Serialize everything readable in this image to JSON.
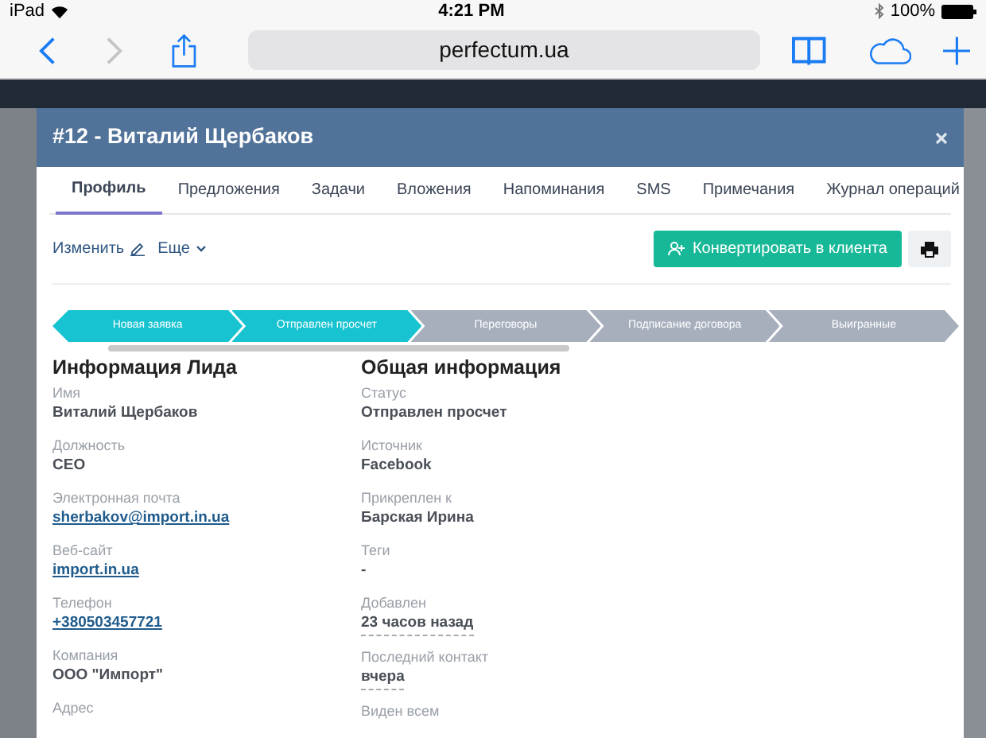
{
  "status_bar": {
    "device": "iPad",
    "time": "4:21 PM",
    "battery": "100%"
  },
  "browser": {
    "url": "perfectum.ua",
    "back_disabled": false,
    "forward_disabled": true
  },
  "modal": {
    "title": "#12 - Виталий Щербаков",
    "tabs": [
      {
        "label": "Профиль",
        "selected": true
      },
      {
        "label": "Предложения",
        "selected": false
      },
      {
        "label": "Задачи",
        "selected": false
      },
      {
        "label": "Вложения",
        "selected": false
      },
      {
        "label": "Напоминания",
        "selected": false
      },
      {
        "label": "SMS",
        "selected": false
      },
      {
        "label": "Примечания",
        "selected": false
      },
      {
        "label": "Журнал операций",
        "selected": false
      }
    ],
    "actions": {
      "edit": "Изменить",
      "more": "Еще",
      "convert": "Конвертировать в клиента"
    },
    "stages": [
      {
        "label": "Новая заявка",
        "reached": true
      },
      {
        "label": "Отправлен просчет",
        "reached": true
      },
      {
        "label": "Переговоры",
        "reached": false
      },
      {
        "label": "Подписание договора",
        "reached": false
      },
      {
        "label": "Выигранные",
        "reached": false
      }
    ],
    "sections": [
      {
        "title": "Информация Лида",
        "fields": [
          {
            "label": "Имя",
            "value": "Виталий Щербаков",
            "kind": "text"
          },
          {
            "label": "Должность",
            "value": "CEO",
            "kind": "text"
          },
          {
            "label": "Электронная почта",
            "value": "sherbakov@import.in.ua",
            "kind": "link"
          },
          {
            "label": "Веб-сайт",
            "value": "import.in.ua",
            "kind": "link"
          },
          {
            "label": "Телефон",
            "value": "+380503457721",
            "kind": "link"
          },
          {
            "label": "Компания",
            "value": "ООО \"Импорт\"",
            "kind": "text"
          },
          {
            "label": "Адрес"
          }
        ]
      },
      {
        "title": "Общая информация",
        "fields": [
          {
            "label": "Статус",
            "value": "Отправлен просчет",
            "kind": "text"
          },
          {
            "label": "Источник",
            "value": "Facebook",
            "kind": "text"
          },
          {
            "label": "Прикреплен к",
            "value": "Барская Ирина",
            "kind": "text"
          },
          {
            "label": "Теги",
            "value": "-",
            "kind": "text"
          },
          {
            "label": "Добавлен",
            "value": "23 часов назад",
            "kind": "date"
          },
          {
            "label": "Последний контакт",
            "value": "вчера",
            "kind": "date"
          },
          {
            "label": "Виден всем"
          }
        ]
      }
    ]
  }
}
